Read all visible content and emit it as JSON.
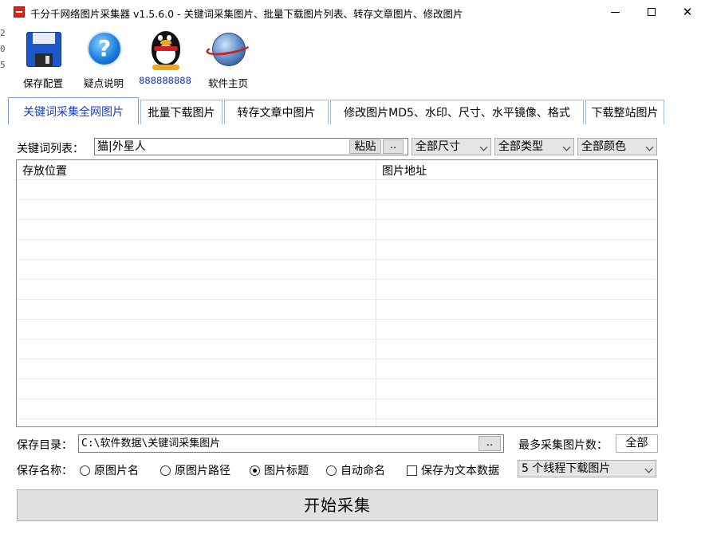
{
  "window": {
    "title": "千分千网络图片采集器 v1.5.6.0 - 关键词采集图片、批量下载图片列表、转存文章图片、修改图片",
    "icon": "app-logo-icon"
  },
  "left_gutter": [
    "2",
    "0",
    "5"
  ],
  "toolbar": {
    "items": [
      {
        "label": "保存配置",
        "icon": "floppy-disk-icon"
      },
      {
        "label": "疑点说明",
        "icon": "help-icon"
      },
      {
        "label": "888888888",
        "icon": "qq-penguin-icon"
      },
      {
        "label": "软件主页",
        "icon": "globe-icon"
      }
    ]
  },
  "tabs": [
    {
      "label": "关键词采集全网图片",
      "active": true
    },
    {
      "label": "批量下载图片",
      "active": false
    },
    {
      "label": "转存文章中图片",
      "active": false
    },
    {
      "label": "修改图片MD5、水印、尺寸、水平镜像、格式",
      "active": false
    },
    {
      "label": "下载整站图片",
      "active": false
    }
  ],
  "keyword": {
    "label": "关键词列表：",
    "value": "猫|外星人",
    "paste_button": "粘贴",
    "more_button": ".."
  },
  "filters": {
    "size": "全部尺寸",
    "type": "全部类型",
    "color": "全部颜色"
  },
  "grid": {
    "columns": [
      "存放位置",
      "图片地址"
    ],
    "rows": []
  },
  "save_dir": {
    "label": "保存目录：",
    "value": "C:\\软件数据\\关键词采集图片",
    "more_button": ".."
  },
  "max_images": {
    "label": "最多采集图片数：",
    "value": "全部"
  },
  "save_name": {
    "label": "保存名称：",
    "options": [
      {
        "label": "原图片名",
        "checked": false
      },
      {
        "label": "原图片路径",
        "checked": false
      },
      {
        "label": "图片标题",
        "checked": true
      },
      {
        "label": "自动命名",
        "checked": false
      }
    ],
    "save_text_label": "保存为文本数据",
    "save_text_checked": false,
    "threads": "5 个线程下载图片"
  },
  "start_button": "开始采集"
}
